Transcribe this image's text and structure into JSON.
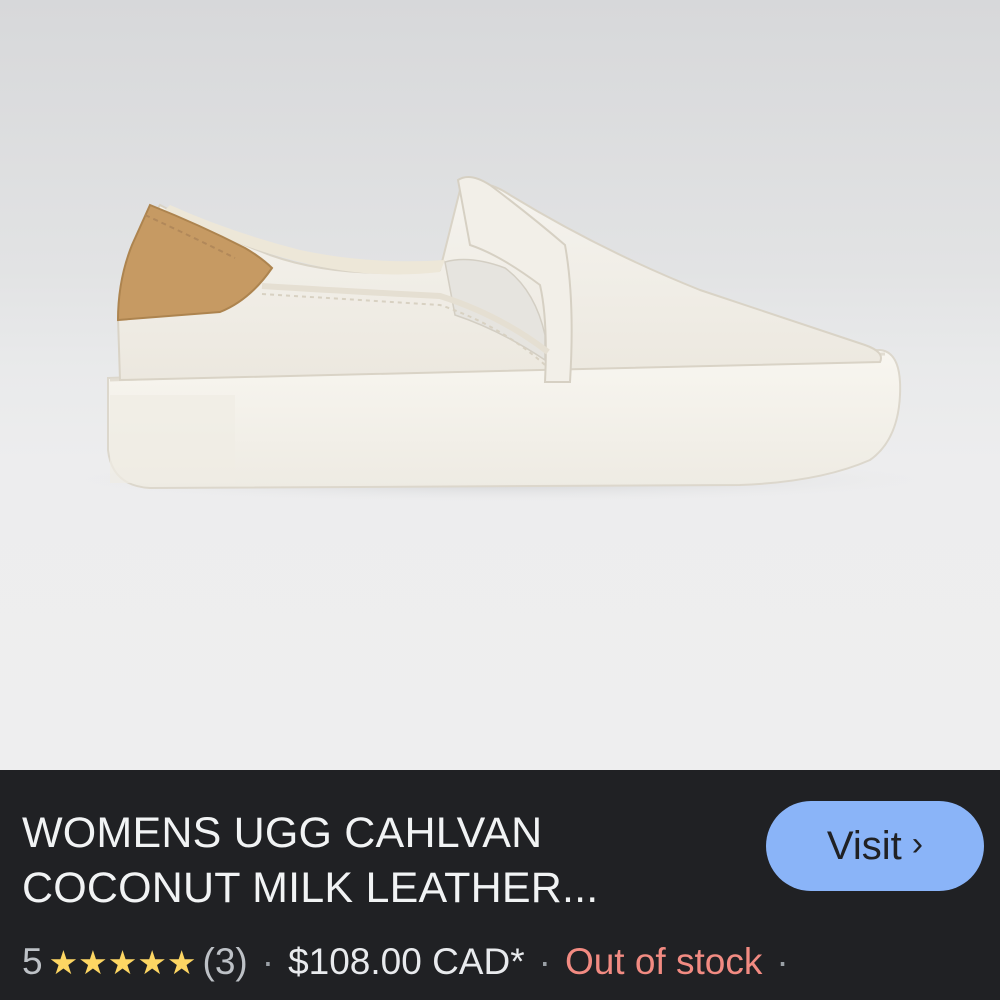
{
  "image": {
    "alt": "WOMENS UGG CAHLVAN COCONUT MILK LEATHER slip-on sneaker"
  },
  "product": {
    "title_line1": "WOMENS UGG CAHLVAN",
    "title_line2": "COCONUT MILK LEATHER..."
  },
  "visit_button": {
    "label": "Visit",
    "chevron": "›"
  },
  "rating": {
    "value": "5",
    "stars": "★★★★★",
    "count": "(3)"
  },
  "separator": "·",
  "price": "$108.00 CAD*",
  "stock_status": "Out of stock",
  "colors": {
    "panel_background": "#202124",
    "visit_button": "#8ab4f8",
    "star": "#fdd663",
    "out_of_stock": "#f28b82"
  }
}
